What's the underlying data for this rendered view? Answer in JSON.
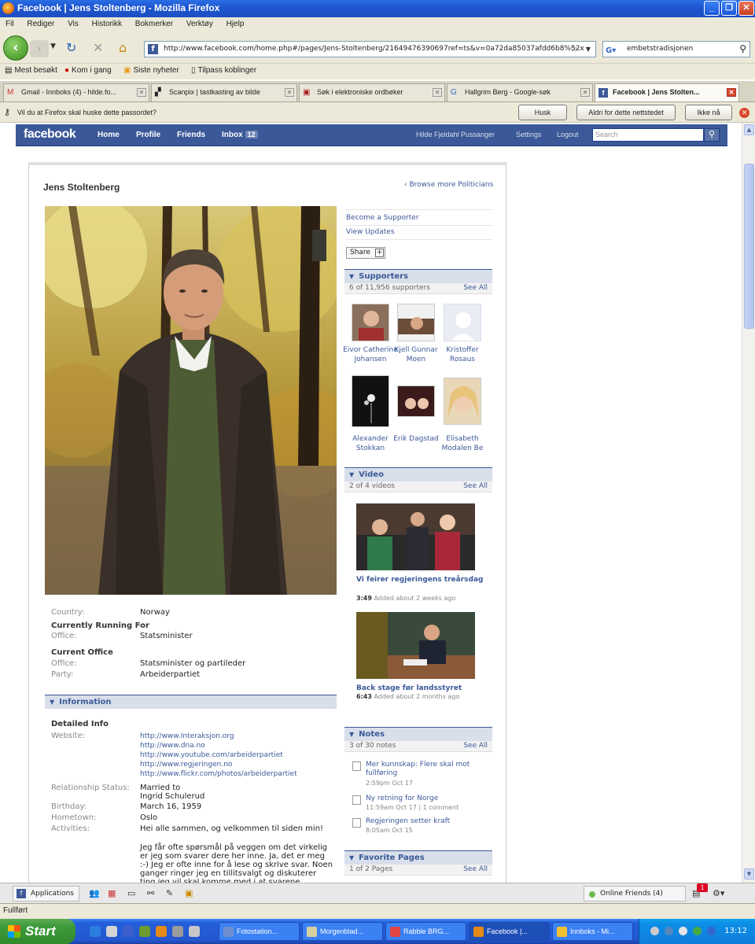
{
  "browser": {
    "title": "Facebook | Jens Stoltenberg - Mozilla Firefox",
    "menu": [
      "Fil",
      "Rediger",
      "Vis",
      "Historikk",
      "Bokmerker",
      "Verktøy",
      "Hjelp"
    ],
    "url": "http://www.facebook.com/home.php#/pages/Jens-Stoltenberg/21649476390697ref=ts&v=0a72da85037afdd6b8%52x",
    "search_value": "embetstradisjonen",
    "bookmarks": [
      "Mest besøkt",
      "Kom i gang",
      "Siste nyheter",
      "Tilpass koblinger"
    ],
    "tabs": [
      "Gmail - Innboks (4) - hilde.fo...",
      "Scanpix | tastkasting av bilde",
      "Søk i elektroniske ordbøker",
      "Hallgrim Berg - Google-søk",
      "Facebook | Jens Stolten..."
    ],
    "password_prompt": "Vil du at Firefox skal huske dette passordet?",
    "password_buttons": [
      "Husk",
      "Aldri for dette nettstedet",
      "Ikke nå"
    ],
    "status": "Fullført"
  },
  "facebook": {
    "logo": "facebook",
    "nav": [
      "Home",
      "Profile",
      "Friends",
      "Inbox"
    ],
    "inbox_count": "12",
    "user": "Hilde Fjeldahl Pussanger",
    "settings": "Settings",
    "logout": "Logout",
    "search_placeholder": "Search"
  },
  "page": {
    "title": "Jens Stoltenberg",
    "browse_link": "Browse more Politicians",
    "become_supporter": "Become a Supporter",
    "view_updates": "View Updates",
    "share": "Share",
    "details": {
      "country_label": "Country:",
      "country": "Norway",
      "running_heading": "Currently Running For",
      "office_label": "Office:",
      "running_office": "Statsminister",
      "current_heading": "Current Office",
      "current_office": "Statsminister og partileder",
      "party_label": "Party:",
      "party": "Arbeiderpartiet"
    },
    "information": {
      "heading": "Information",
      "detailed_info": "Detailed Info",
      "website_label": "Website:",
      "websites": [
        "http://www.Interaksjon.org",
        "http://www.dna.no",
        "http://www.youtube.com/arbeiderpartiet",
        "http://www.regjeringen.no",
        "http://www.flickr.com/photos/arbeiderpartiet"
      ],
      "relationship_label": "Relationship Status:",
      "relationship": "Married to",
      "spouse": "Ingrid Schulerud",
      "birthday_label": "Birthday:",
      "birthday": "March 16, 1959",
      "hometown_label": "Hometown:",
      "hometown": "Oslo",
      "activities_label": "Activities:",
      "activities": "Hei alle sammen, og velkommen til siden min!",
      "activities_more": "Jeg får ofte spørsmål på veggen om det virkelig er jeg som svarer dere her inne. Ja, det er meg :-) Jeg er ofte inne for å lese og skrive svar. Noen ganger ringer jeg en tillitsvalgt og diskuterer ting jeg vil skal komme med i at svarene"
    },
    "supporters": {
      "heading": "Supporters",
      "count": "6 of 11,956 supporters",
      "see_all": "See All",
      "people": [
        "Eivor Catherine Johansen",
        "Kjell Gunnar Moen",
        "Kristoffer Rosaus",
        "Alexander Stokkan",
        "Erik Dagstad",
        "Elisabeth Modalen Be"
      ]
    },
    "video": {
      "heading": "Video",
      "count": "2 of 4 videos",
      "see_all": "See All",
      "items": [
        {
          "title": "Vi feirer regjeringens treårsdag",
          "duration": "3:49",
          "added": "Added about 2 weeks ago"
        },
        {
          "title": "Back stage før landsstyret",
          "duration": "6:43",
          "added": "Added about 2 months ago"
        }
      ]
    },
    "notes": {
      "heading": "Notes",
      "count": "3 of 30 notes",
      "see_all": "See All",
      "items": [
        {
          "title": "Mer kunnskap: Flere skal mot fullføring",
          "meta": "2:59pm Oct 17"
        },
        {
          "title": "Ny retning for Norge",
          "meta": "11:59am Oct 17 | 1 comment"
        },
        {
          "title": "Regjeringen setter kraft",
          "meta": "8:05am Oct 15"
        }
      ]
    },
    "favorite_pages": {
      "heading": "Favorite Pages",
      "count": "1 of 2 Pages",
      "see_all": "See All"
    }
  },
  "chat": {
    "applications": "Applications",
    "online_friends": "Online Friends (4)",
    "notification_count": "1"
  },
  "taskbar": {
    "start": "Start",
    "tasks": [
      "Fotostation...",
      "Morgenblad...",
      "Rabble BRG...",
      "Facebook |...",
      "Innboks - Mi..."
    ],
    "clock": "13:12"
  }
}
